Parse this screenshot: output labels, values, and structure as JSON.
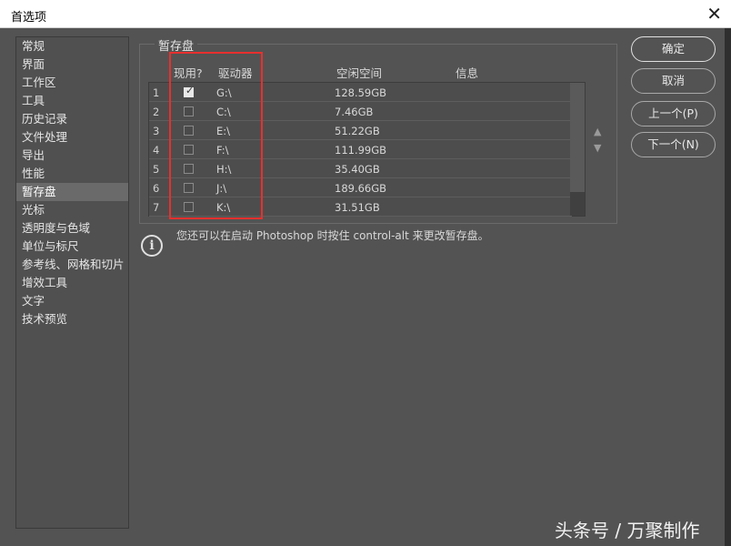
{
  "window": {
    "title": "首选项"
  },
  "sidebar": {
    "items": [
      {
        "label": "常规"
      },
      {
        "label": "界面"
      },
      {
        "label": "工作区"
      },
      {
        "label": "工具"
      },
      {
        "label": "历史记录"
      },
      {
        "label": "文件处理"
      },
      {
        "label": "导出"
      },
      {
        "label": "性能"
      },
      {
        "label": "暂存盘",
        "active": true
      },
      {
        "label": "光标"
      },
      {
        "label": "透明度与色域"
      },
      {
        "label": "单位与标尺"
      },
      {
        "label": "参考线、网格和切片"
      },
      {
        "label": "增效工具"
      },
      {
        "label": "文字"
      },
      {
        "label": "技术预览"
      }
    ]
  },
  "scratch": {
    "group_title": "暂存盘",
    "columns": {
      "active": "现用?",
      "drive": "驱动器",
      "free_space": "空闲空间",
      "info": "信息"
    },
    "rows": [
      {
        "num": "1",
        "checked": true,
        "drive": "G:\\",
        "space": "128.59GB"
      },
      {
        "num": "2",
        "checked": false,
        "drive": "C:\\",
        "space": "7.46GB"
      },
      {
        "num": "3",
        "checked": false,
        "drive": "E:\\",
        "space": "51.22GB"
      },
      {
        "num": "4",
        "checked": false,
        "drive": "F:\\",
        "space": "111.99GB"
      },
      {
        "num": "5",
        "checked": false,
        "drive": "H:\\",
        "space": "35.40GB"
      },
      {
        "num": "6",
        "checked": false,
        "drive": "J:\\",
        "space": "189.66GB"
      },
      {
        "num": "7",
        "checked": false,
        "drive": "K:\\",
        "space": "31.51GB"
      }
    ],
    "move_up": "▲",
    "move_down": "▼",
    "info_icon": "i",
    "info_text": "您还可以在启动 Photoshop 时按住 control-alt 来更改暂存盘。"
  },
  "buttons": {
    "ok": "确定",
    "cancel": "取消",
    "prev": "上一个(P)",
    "next": "下一个(N)"
  },
  "watermark": "头条号 / 万聚制作",
  "colors": {
    "background": "#535353",
    "highlight": "#e8302e"
  }
}
